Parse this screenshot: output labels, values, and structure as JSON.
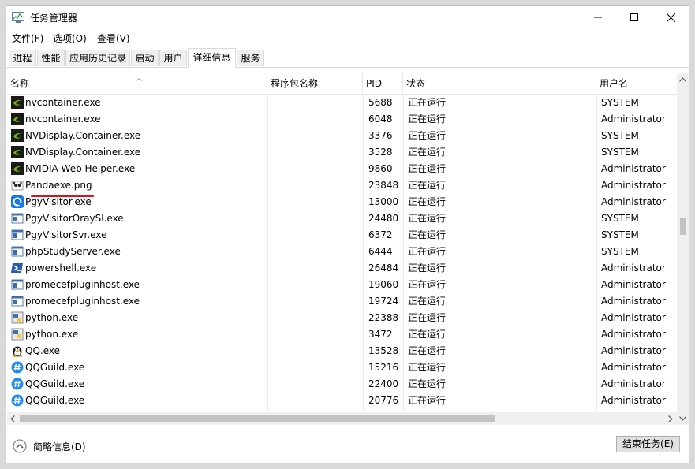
{
  "window": {
    "title": "任务管理器",
    "minimize_glyph": "—",
    "maximize_glyph": "☐",
    "close_glyph": "✕"
  },
  "menu": [
    "文件(F)",
    "选项(O)",
    "查看(V)"
  ],
  "tabs": [
    {
      "label": "进程",
      "active": false
    },
    {
      "label": "性能",
      "active": false
    },
    {
      "label": "应用历史记录",
      "active": false
    },
    {
      "label": "启动",
      "active": false
    },
    {
      "label": "用户",
      "active": false
    },
    {
      "label": "详细信息",
      "active": true
    },
    {
      "label": "服务",
      "active": false
    }
  ],
  "columns": {
    "name": "名称",
    "package": "程序包名称",
    "pid": "PID",
    "status": "状态",
    "user": "用户名"
  },
  "rows": [
    {
      "name": "nvcontainer.exe",
      "pid": "5688",
      "status": "正在运行",
      "user": "SYSTEM",
      "icon": "nvidia-icon"
    },
    {
      "name": "nvcontainer.exe",
      "pid": "6048",
      "status": "正在运行",
      "user": "Administrator",
      "icon": "nvidia-icon"
    },
    {
      "name": "NVDisplay.Container.exe",
      "pid": "3376",
      "status": "正在运行",
      "user": "SYSTEM",
      "icon": "nvidia-icon"
    },
    {
      "name": "NVDisplay.Container.exe",
      "pid": "3528",
      "status": "正在运行",
      "user": "SYSTEM",
      "icon": "nvidia-icon"
    },
    {
      "name": "NVIDIA Web Helper.exe",
      "pid": "9860",
      "status": "正在运行",
      "user": "Administrator",
      "icon": "nvidia-icon"
    },
    {
      "name": "Pandaexe.png",
      "pid": "23848",
      "status": "正在运行",
      "user": "Administrator",
      "icon": "panda-icon"
    },
    {
      "name": "PgyVisitor.exe",
      "pid": "13000",
      "status": "正在运行",
      "user": "Administrator",
      "icon": "pgy-icon"
    },
    {
      "name": "PgyVisitorOraySl.exe",
      "pid": "24480",
      "status": "正在运行",
      "user": "SYSTEM",
      "icon": "app-window-icon"
    },
    {
      "name": "PgyVisitorSvr.exe",
      "pid": "6372",
      "status": "正在运行",
      "user": "SYSTEM",
      "icon": "app-window-icon"
    },
    {
      "name": "phpStudyServer.exe",
      "pid": "6444",
      "status": "正在运行",
      "user": "SYSTEM",
      "icon": "app-window-icon"
    },
    {
      "name": "powershell.exe",
      "pid": "26484",
      "status": "正在运行",
      "user": "Administrator",
      "icon": "powershell-icon"
    },
    {
      "name": "promecefpluginhost.exe",
      "pid": "19060",
      "status": "正在运行",
      "user": "Administrator",
      "icon": "app-window-icon"
    },
    {
      "name": "promecefpluginhost.exe",
      "pid": "19724",
      "status": "正在运行",
      "user": "Administrator",
      "icon": "app-window-icon"
    },
    {
      "name": "python.exe",
      "pid": "22388",
      "status": "正在运行",
      "user": "Administrator",
      "icon": "python-icon"
    },
    {
      "name": "python.exe",
      "pid": "3472",
      "status": "正在运行",
      "user": "Administrator",
      "icon": "python-icon"
    },
    {
      "name": "QQ.exe",
      "pid": "13528",
      "status": "正在运行",
      "user": "Administrator",
      "icon": "qq-penguin-icon"
    },
    {
      "name": "QQGuild.exe",
      "pid": "15216",
      "status": "正在运行",
      "user": "Administrator",
      "icon": "qqguild-icon"
    },
    {
      "name": "QQGuild.exe",
      "pid": "22400",
      "status": "正在运行",
      "user": "Administrator",
      "icon": "qqguild-icon"
    },
    {
      "name": "QQGuild.exe",
      "pid": "20776",
      "status": "正在运行",
      "user": "Administrator",
      "icon": "qqguild-icon"
    }
  ],
  "footer": {
    "less_details": "简略信息(D)",
    "end_task": "结束任务(E)"
  },
  "colors": {
    "nvidia_green": "#76b900",
    "qq_blue": "#1e8ef0",
    "annotation_red": "#e0101a"
  }
}
